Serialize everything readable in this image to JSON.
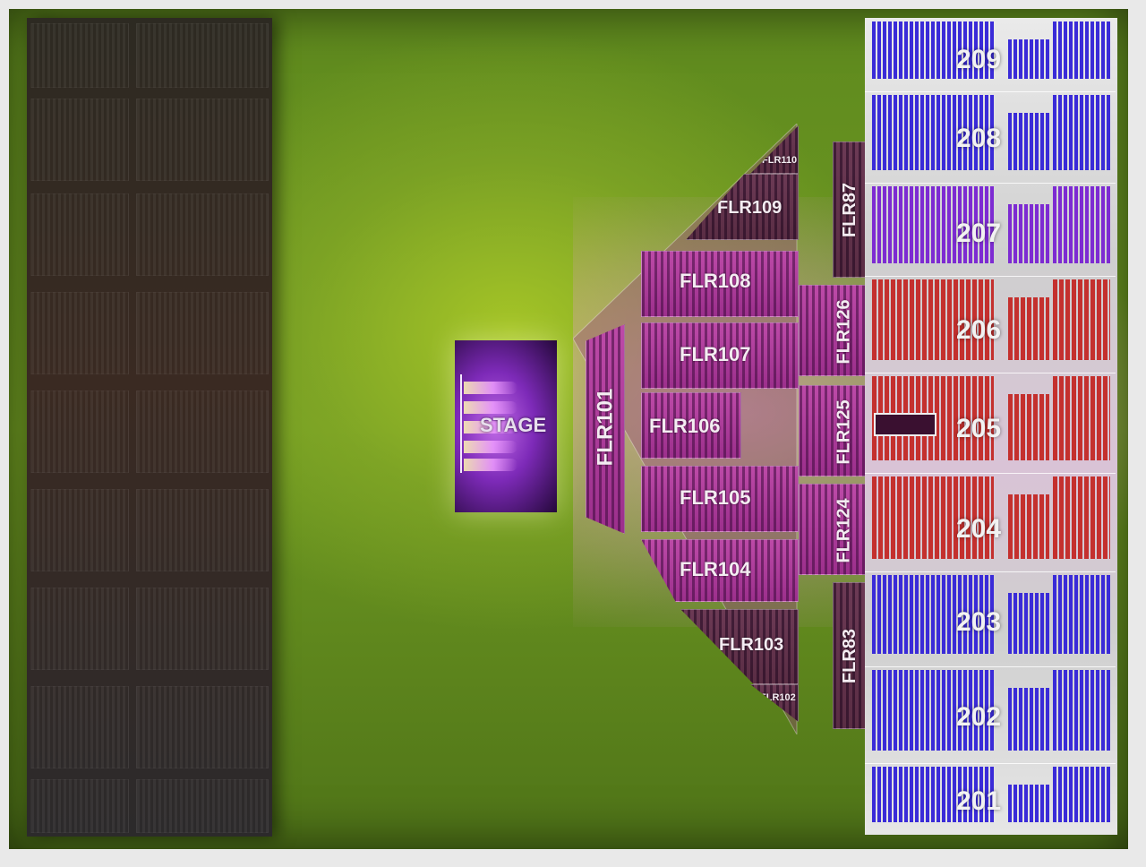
{
  "map": {
    "stage_label": "STAGE",
    "floor_sections": [
      "FLR101",
      "FLR102",
      "FLR103",
      "FLR104",
      "FLR105",
      "FLR106",
      "FLR107",
      "FLR108",
      "FLR109",
      "FLR110"
    ],
    "side_floor_sections": [
      "FLR87",
      "FLR126",
      "FLR125",
      "FLR124",
      "FLR83"
    ],
    "upper_sections": [
      "209",
      "208",
      "207",
      "206",
      "205",
      "204",
      "203",
      "202",
      "201"
    ],
    "colors": {
      "field": "#7aa424",
      "floor": "#b8449f",
      "upper_blue": "#3a2bd8",
      "upper_violet": "#7d2bd2",
      "upper_red": "#c4302e",
      "dark_stands": "#2f2a26"
    }
  }
}
